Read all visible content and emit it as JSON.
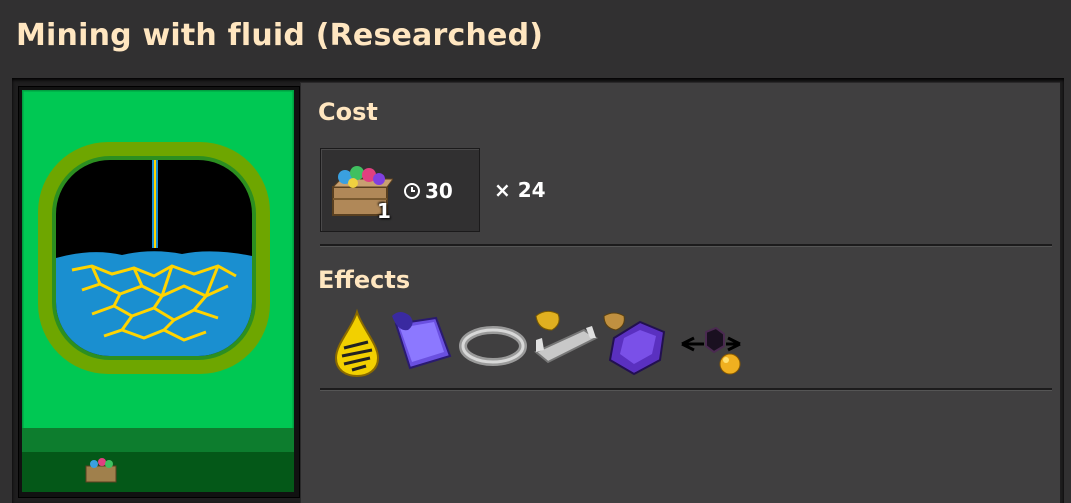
{
  "header": {
    "title": "Mining with fluid (Researched)"
  },
  "technology": {
    "icon": "mining-with-fluid-icon",
    "pack_icon": "automation-science-pack-icon"
  },
  "cost": {
    "label": "Cost",
    "pack_icon": "automation-science-pack-icon",
    "pack_count": "1",
    "time_icon": "clock-icon",
    "time": "30",
    "multiplier": "× 24"
  },
  "effects": {
    "label": "Effects",
    "items": [
      {
        "icon": "sulfuric-acid-drop-icon"
      },
      {
        "icon": "uranium-mining-plate-icon"
      },
      {
        "icon": "steel-ring-icon"
      },
      {
        "icon": "steel-channel-ore-icon"
      },
      {
        "icon": "purple-ore-gold-icon"
      },
      {
        "icon": "mining-drill-fluid-io-icon"
      }
    ]
  },
  "colors": {
    "title": "#ffe6c0",
    "tech_background": "#00c853",
    "fluid": "#1a8fd0",
    "ore_veins": "#ffd400"
  }
}
